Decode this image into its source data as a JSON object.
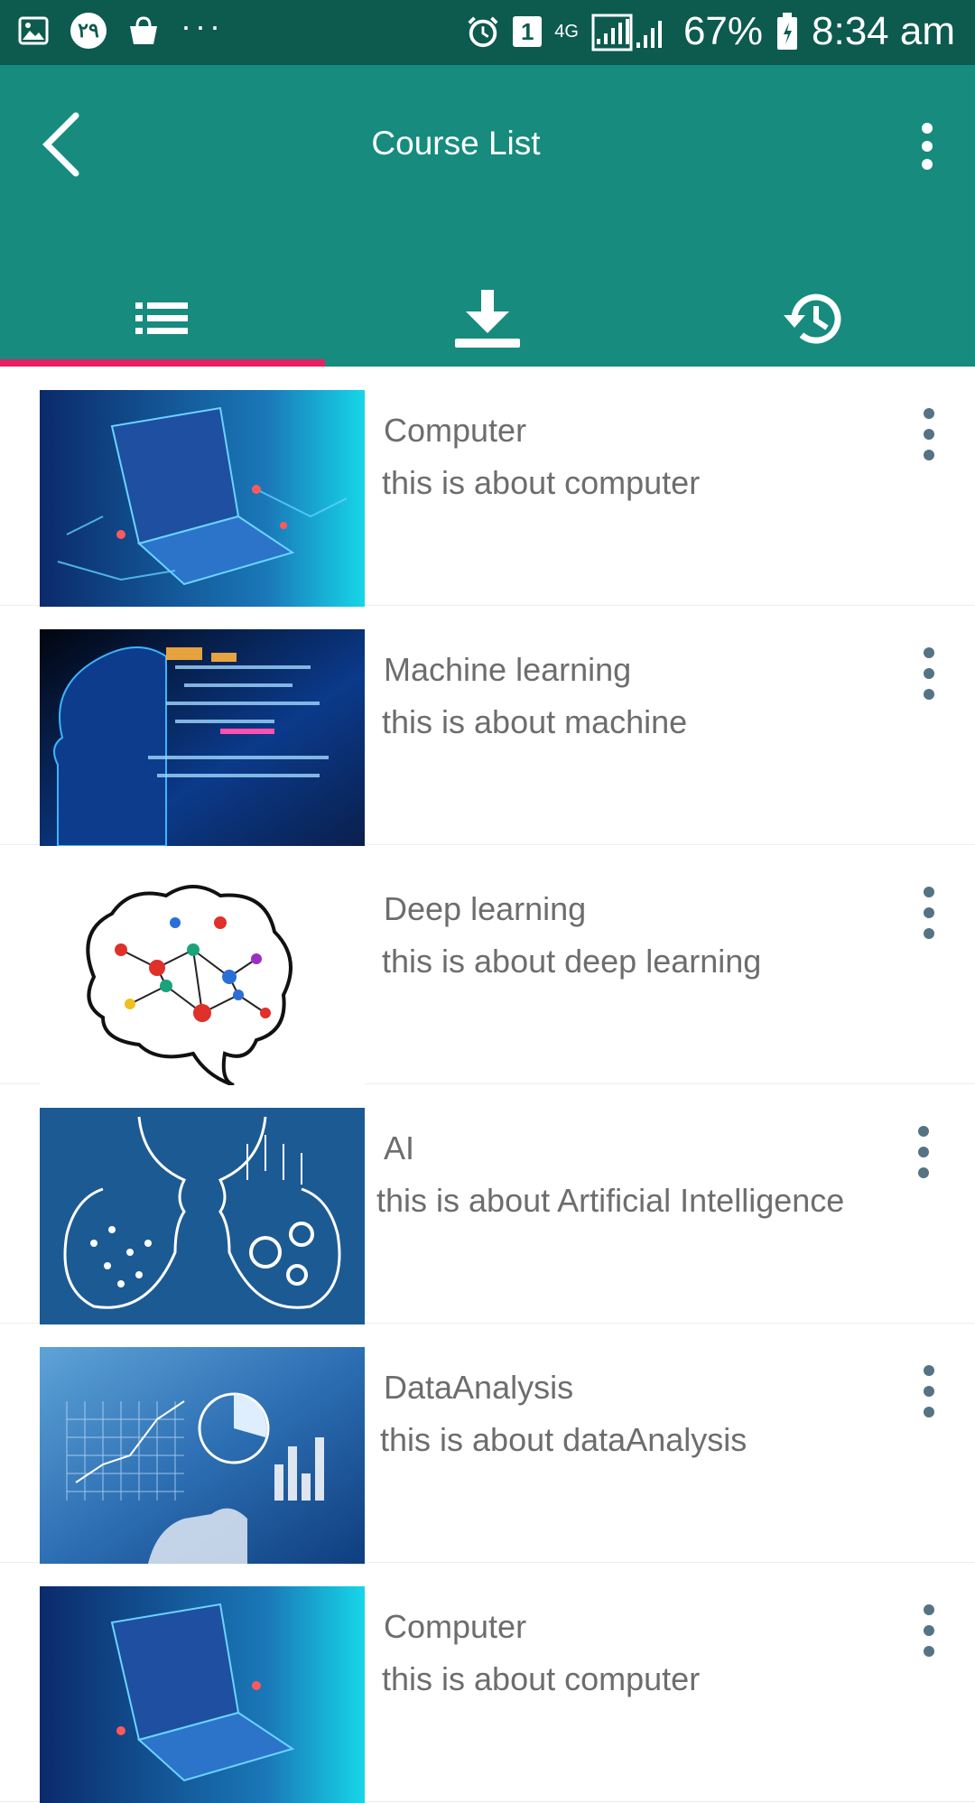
{
  "status_bar": {
    "left_icons": [
      "gallery-icon",
      "notification-badge-icon",
      "shopping-bag-icon"
    ],
    "badge_text": "٢٩",
    "overflow": "···",
    "sim_slot": "1",
    "network": "4G",
    "battery": "67%",
    "time": "8:34 am"
  },
  "app_bar": {
    "title": "Course List",
    "back_icon": "chevron-left-icon",
    "menu_icon": "more-vertical-icon"
  },
  "tabs": [
    {
      "icon": "list-icon",
      "selected": true
    },
    {
      "icon": "download-icon",
      "selected": false
    },
    {
      "icon": "history-icon",
      "selected": false
    }
  ],
  "colors": {
    "status_bar": "#0d5a4f",
    "primary": "#168b7e",
    "indicator": "#e91e63",
    "text": "#6d6d6d"
  },
  "courses": [
    {
      "name": "Computer",
      "description": "this is about computer"
    },
    {
      "name": "Machine learning",
      "description": "this is about machine"
    },
    {
      "name": "Deep learning",
      "description": "this is about deep learning"
    },
    {
      "name": "AI",
      "description": "this is about Artificial Intelligence"
    },
    {
      "name": "DataAnalysis",
      "description": "this is about dataAnalysis"
    },
    {
      "name": "Computer",
      "description": "this is about computer"
    }
  ]
}
